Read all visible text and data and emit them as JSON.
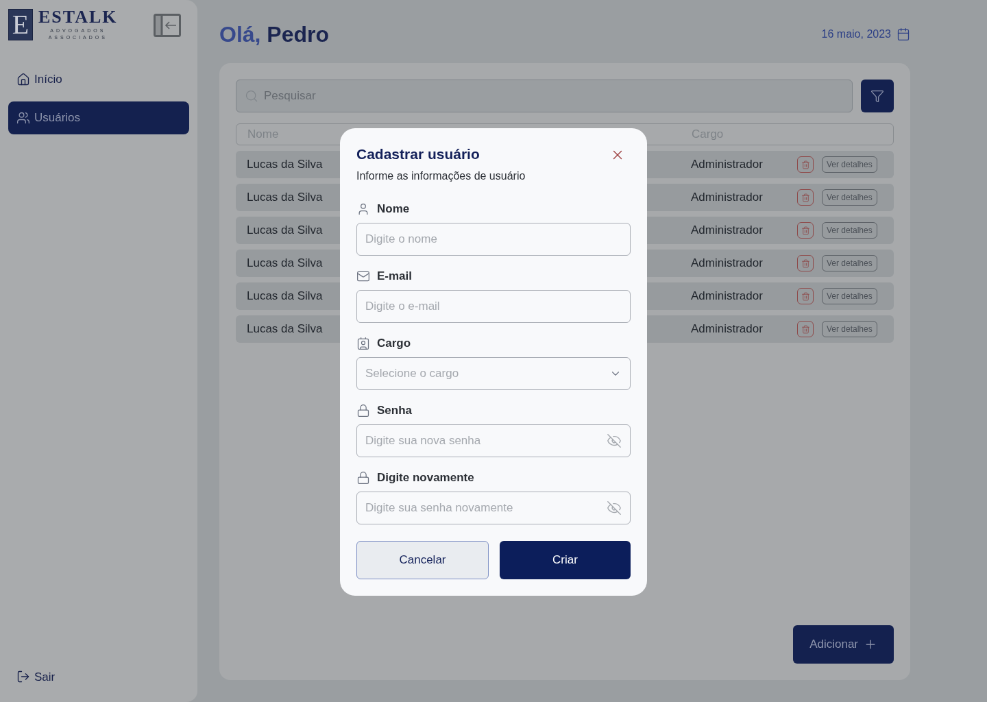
{
  "sidebar": {
    "logo": {
      "letter": "E",
      "name": "ESTALK",
      "line1": "ADVOGADOS",
      "line2": "ASSOCIADOS"
    },
    "items": [
      {
        "label": "Início",
        "selected": false
      },
      {
        "label": "Usuários",
        "selected": true
      }
    ],
    "logout": "Sair"
  },
  "header": {
    "greeting": "Olá,",
    "name": "Pedro",
    "date": "16 maio, 2023"
  },
  "search": {
    "placeholder": "Pesquisar"
  },
  "table": {
    "columns": [
      "Nome",
      "Cargo"
    ],
    "rows": [
      {
        "name": "Lucas da Silva",
        "role": "Administrador",
        "action": "Ver detalhes"
      },
      {
        "name": "Lucas da Silva",
        "role": "Administrador",
        "action": "Ver detalhes"
      },
      {
        "name": "Lucas da Silva",
        "role": "Administrador",
        "action": "Ver detalhes"
      },
      {
        "name": "Lucas da Silva",
        "role": "Administrador",
        "action": "Ver detalhes"
      },
      {
        "name": "Lucas da Silva",
        "role": "Administrador",
        "action": "Ver detalhes"
      },
      {
        "name": "Lucas da Silva",
        "role": "Administrador",
        "action": "Ver detalhes"
      }
    ]
  },
  "add_button": "Adicionar",
  "modal": {
    "title": "Cadastrar usuário",
    "subtitle": "Informe as informações de usuário",
    "fields": [
      {
        "label": "Nome",
        "kind": "text",
        "placeholder": "Digite o nome"
      },
      {
        "label": "E-mail",
        "kind": "text",
        "placeholder": "Digite o e-mail"
      },
      {
        "label": "Cargo",
        "kind": "select",
        "placeholder": "Selecione o cargo"
      },
      {
        "label": "Senha",
        "kind": "password",
        "placeholder": "Digite sua nova senha"
      },
      {
        "label": "Digite novamente",
        "kind": "password",
        "placeholder": "Digite sua senha novamente"
      }
    ],
    "cancel": "Cancelar",
    "submit": "Criar"
  }
}
